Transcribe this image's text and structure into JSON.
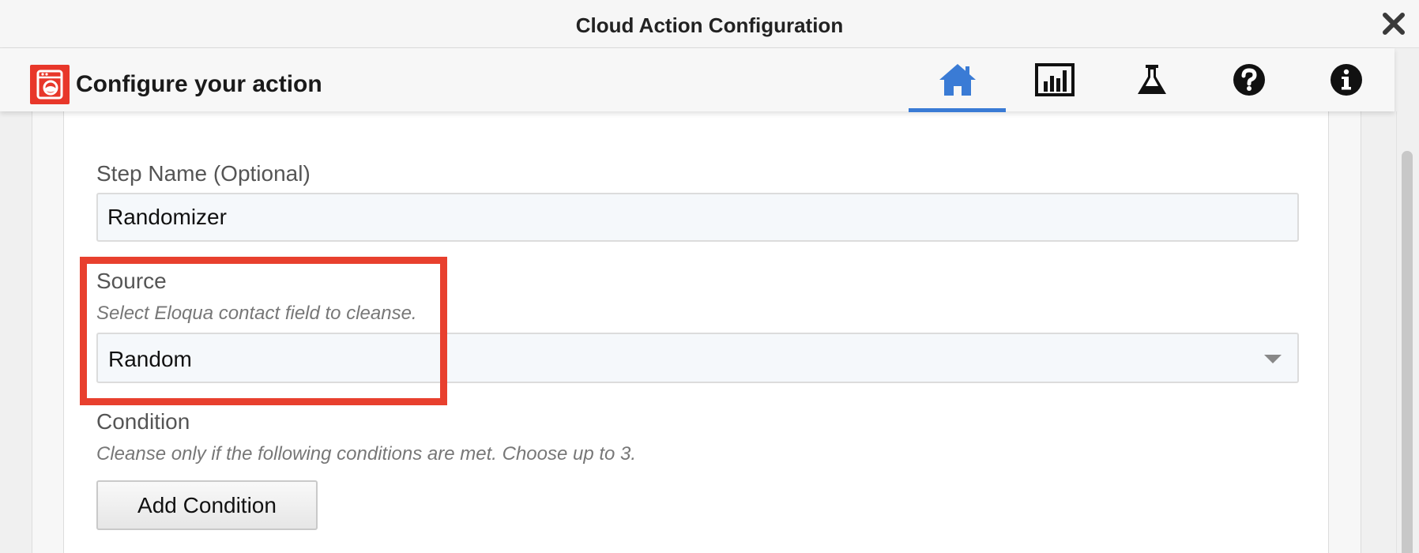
{
  "window": {
    "title": "Cloud Action Configuration"
  },
  "header": {
    "heading": "Configure your action",
    "nav_tabs": [
      {
        "icon": "home-icon",
        "active": true
      },
      {
        "icon": "bar-chart-icon",
        "active": false
      },
      {
        "icon": "flask-icon",
        "active": false
      },
      {
        "icon": "help-icon",
        "active": false
      },
      {
        "icon": "info-icon",
        "active": false
      }
    ]
  },
  "form": {
    "step_name": {
      "label": "Step Name (Optional)",
      "value": "Randomizer"
    },
    "source": {
      "label": "Source",
      "help": "Select Eloqua contact field to cleanse.",
      "selected": "Random"
    },
    "condition": {
      "label": "Condition",
      "help": "Cleanse only if the following conditions are met. Choose up to 3.",
      "add_button": "Add Condition"
    }
  },
  "colors": {
    "accent": "#3a7bd5",
    "brand": "#e8372a",
    "highlight": "#e8402e"
  }
}
